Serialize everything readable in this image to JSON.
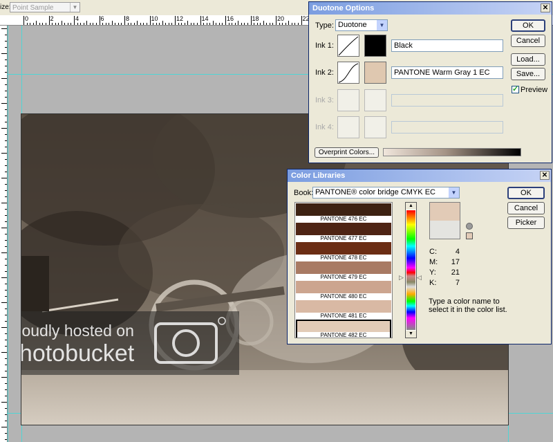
{
  "options_bar": {
    "size_label": "ize:",
    "sample_value": "Point Sample"
  },
  "ruler": {
    "numbers": [
      "0",
      "2",
      "4",
      "6",
      "8",
      "10",
      "12",
      "14",
      "16",
      "18",
      "20",
      "22"
    ]
  },
  "duotone": {
    "title": "Duotone Options",
    "type_label": "Type:",
    "type_value": "Duotone",
    "ink1_label": "Ink 1:",
    "ink1_name": "Black",
    "ink1_color": "#000000",
    "ink2_label": "Ink 2:",
    "ink2_name": "PANTONE Warm Gray 1 EC",
    "ink2_color": "#dfc8b0",
    "ink3_label": "Ink 3:",
    "ink4_label": "Ink 4:",
    "overprint_label": "Overprint Colors...",
    "ok": "OK",
    "cancel": "Cancel",
    "load": "Load...",
    "save": "Save...",
    "preview_label": "Preview",
    "preview_checked": true
  },
  "colorlib": {
    "title": "Color Libraries",
    "book_label": "Book:",
    "book_value": "PANTONE® color bridge CMYK EC",
    "ok": "OK",
    "cancel": "Cancel",
    "picker": "Picker",
    "swatches": [
      {
        "name": "PANTONE 476 EC",
        "color": "#3d2213"
      },
      {
        "name": "PANTONE 477 EC",
        "color": "#4e2414"
      },
      {
        "name": "PANTONE 478 EC",
        "color": "#6b2d14"
      },
      {
        "name": "PANTONE 479 EC",
        "color": "#a87a63"
      },
      {
        "name": "PANTONE 480 EC",
        "color": "#cca58f"
      },
      {
        "name": "PANTONE 481 EC",
        "color": "#d9b9a4"
      },
      {
        "name": "PANTONE 482 EC",
        "color": "#e2cbb7"
      }
    ],
    "selected_index": 6,
    "current_color": "#e2cbb7",
    "previous_color": "#e4e4e0",
    "cmyk": [
      {
        "label": "C:",
        "value": "4"
      },
      {
        "label": "M:",
        "value": "17"
      },
      {
        "label": "Y:",
        "value": "21"
      },
      {
        "label": "K:",
        "value": "7"
      }
    ],
    "hint": "Type a color name to select it in the color list."
  },
  "watermark": {
    "line1": "proudly hosted on",
    "line2": "photobucket"
  }
}
